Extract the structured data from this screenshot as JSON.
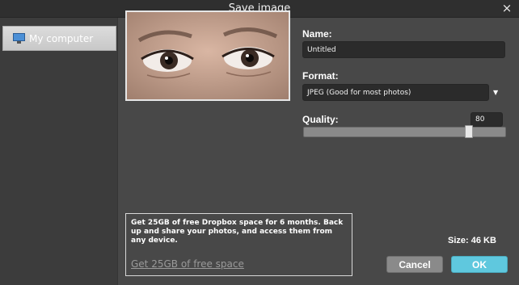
{
  "window": {
    "title": "Save image",
    "close_glyph": "×"
  },
  "sidebar": {
    "items": [
      {
        "label": "My computer",
        "icon": "monitor-icon",
        "selected": true
      }
    ]
  },
  "name": {
    "label": "Name:",
    "value": "Untitled"
  },
  "format": {
    "label": "Format:",
    "value": "JPEG (Good for most photos)",
    "arrow": "▼"
  },
  "quality": {
    "label": "Quality:",
    "value": "80",
    "max": 100
  },
  "promo": {
    "text": "Get 25GB of free Dropbox space for 6 months. Back up and share your photos, and access them from any device.",
    "link": "Get 25GB of free space"
  },
  "size": {
    "label": "Size: 46 KB"
  },
  "buttons": {
    "cancel": "Cancel",
    "ok": "OK"
  },
  "colors": {
    "accent": "#5fc8de",
    "panel": "#484848",
    "sidebar": "#3c3c3c",
    "titlebar": "#2f2f2f"
  }
}
